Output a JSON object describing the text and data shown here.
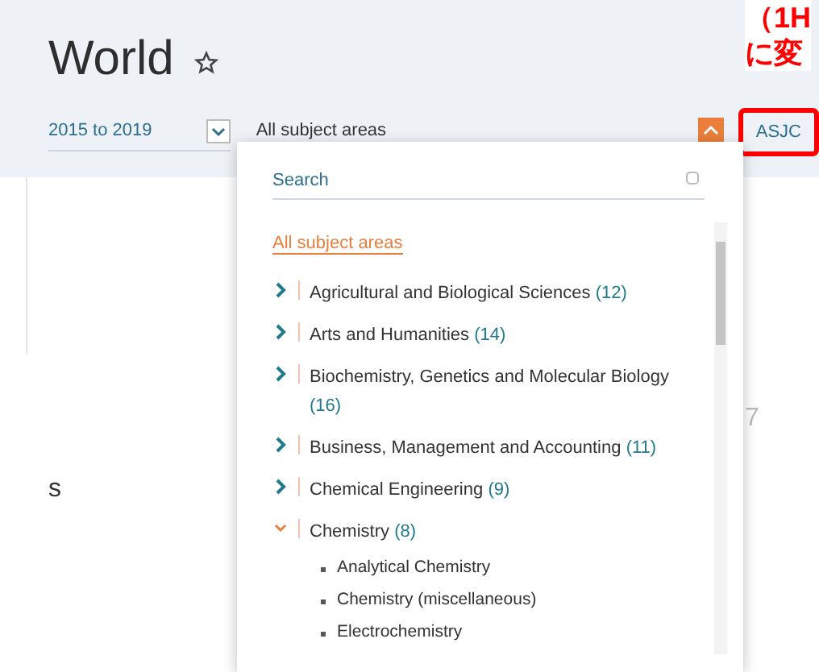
{
  "page": {
    "title": "World"
  },
  "filters": {
    "year_range": "2015 to 2019",
    "subject": "All subject areas",
    "subject_open": true,
    "scheme_button": "ASJC",
    "scheme_highlighted": true
  },
  "dropdown": {
    "search_placeholder": "Search",
    "all_label": "All subject areas",
    "items": [
      {
        "label": "Agricultural and Biological Sciences",
        "count": "(12)",
        "expanded": false
      },
      {
        "label": "Arts and Humanities",
        "count": "(14)",
        "expanded": false
      },
      {
        "label": "Biochemistry, Genetics and Molecular Biology",
        "count": "(16)",
        "expanded": false
      },
      {
        "label": "Business, Management and Accounting",
        "count": "(11)",
        "expanded": false
      },
      {
        "label": "Chemical Engineering",
        "count": "(9)",
        "expanded": false
      },
      {
        "label": "Chemistry",
        "count": "(8)",
        "expanded": true,
        "children": [
          {
            "label": "Analytical Chemistry"
          },
          {
            "label": "Chemistry (miscellaneous)"
          },
          {
            "label": "Electrochemistry"
          }
        ]
      }
    ]
  },
  "annotation": {
    "lines": [
      "（1H",
      "に変"
    ]
  },
  "background_fragments": [
    "s",
    "7"
  ]
}
